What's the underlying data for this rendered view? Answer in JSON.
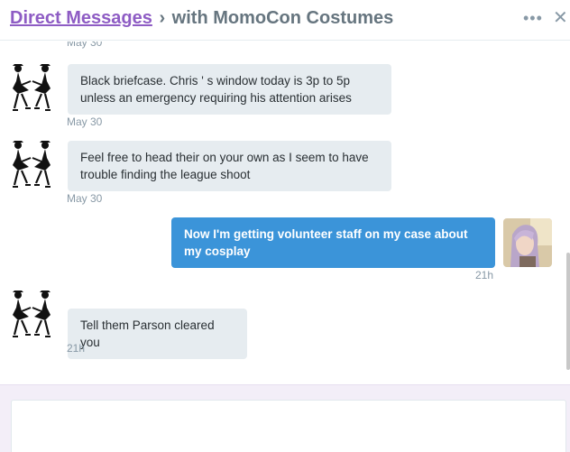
{
  "header": {
    "breadcrumb_link": "Direct Messages",
    "separator": "›",
    "conversation_title": "with MomoCon Costumes",
    "more_icon": "ellipsis-icon",
    "close_icon": "close-icon"
  },
  "messages": [
    {
      "direction": "in",
      "text": "",
      "time": "May 30"
    },
    {
      "direction": "in",
      "text": "Black briefcase. Chris ' s window today is 3p to 5p unless an emergency requiring his attention arises",
      "time": "May 30"
    },
    {
      "direction": "in",
      "text": "Feel free to head their on your own as I seem to have trouble finding the league shoot",
      "time": "May 30"
    },
    {
      "direction": "out",
      "text": "Now I'm getting volunteer staff on my case about my cosplay",
      "time": "21h"
    },
    {
      "direction": "in",
      "text": "Tell them Parson cleared you",
      "time": "21h"
    }
  ],
  "composer": {
    "placeholder": "",
    "value": ""
  },
  "colors": {
    "link": "#8e5cc4",
    "incoming_bubble": "#e6ecf0",
    "outgoing_bubble": "#3b94d9",
    "timestamp": "#8899a6"
  }
}
